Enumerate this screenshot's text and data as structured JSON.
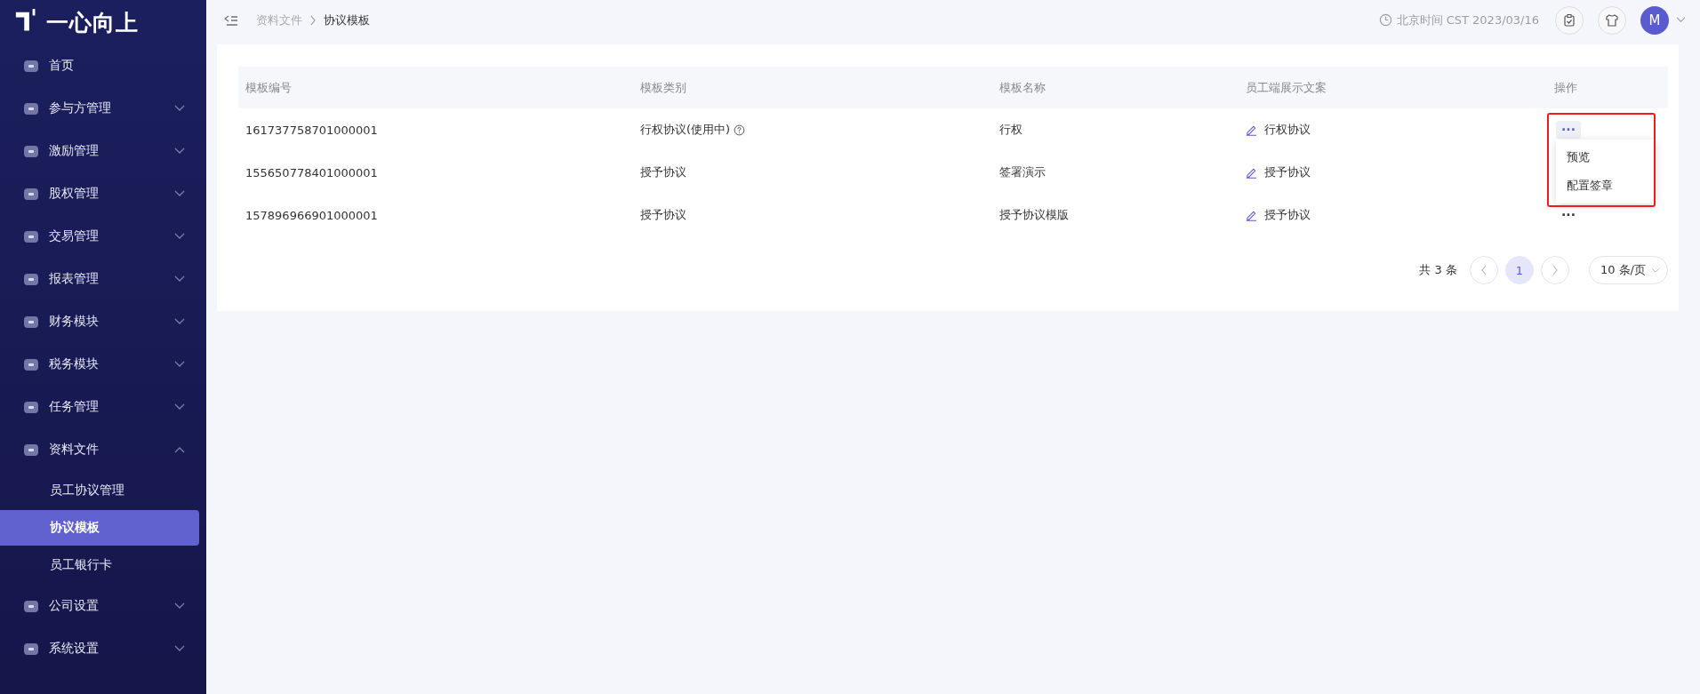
{
  "logo": {
    "text": "一心向上"
  },
  "sidebar": {
    "items": [
      {
        "label": "首页"
      },
      {
        "label": "参与方管理",
        "expanded": false
      },
      {
        "label": "激励管理",
        "expanded": false
      },
      {
        "label": "股权管理",
        "expanded": false
      },
      {
        "label": "交易管理",
        "expanded": false
      },
      {
        "label": "报表管理",
        "expanded": false
      },
      {
        "label": "财务模块",
        "expanded": false
      },
      {
        "label": "税务模块",
        "expanded": false
      },
      {
        "label": "任务管理",
        "expanded": false
      },
      {
        "label": "资料文件",
        "expanded": true,
        "children": [
          {
            "label": "员工协议管理",
            "selected": false
          },
          {
            "label": "协议模板",
            "selected": true
          },
          {
            "label": "员工银行卡",
            "selected": false
          }
        ]
      },
      {
        "label": "公司设置",
        "expanded": false
      },
      {
        "label": "系统设置",
        "expanded": false
      }
    ]
  },
  "header": {
    "breadcrumb": [
      "资料文件",
      "协议模板"
    ],
    "time": "北京时间 CST 2023/03/16",
    "avatar": "M"
  },
  "table": {
    "columns": [
      "模板编号",
      "模板类别",
      "模板名称",
      "员工端展示文案",
      "操作"
    ],
    "rows": [
      {
        "id": "161737758701000001",
        "category": "行权协议(使用中)",
        "has_help": true,
        "name": "行权",
        "display": "行权协议",
        "actions": "···",
        "menu_open": true
      },
      {
        "id": "155650778401000001",
        "category": "授予协议",
        "name": "签署演示",
        "display": "授予协议"
      },
      {
        "id": "157896966901000001",
        "category": "授予协议",
        "name": "授予协议模版",
        "display": "授予协议",
        "actions": "···"
      }
    ],
    "menu": {
      "items": [
        "预览",
        "配置签章"
      ],
      "highlighted": true
    }
  },
  "pagination": {
    "total": "共 3 条",
    "pages": [
      {
        "label": "1",
        "selected": true
      }
    ],
    "page_size": "10 条/页"
  }
}
